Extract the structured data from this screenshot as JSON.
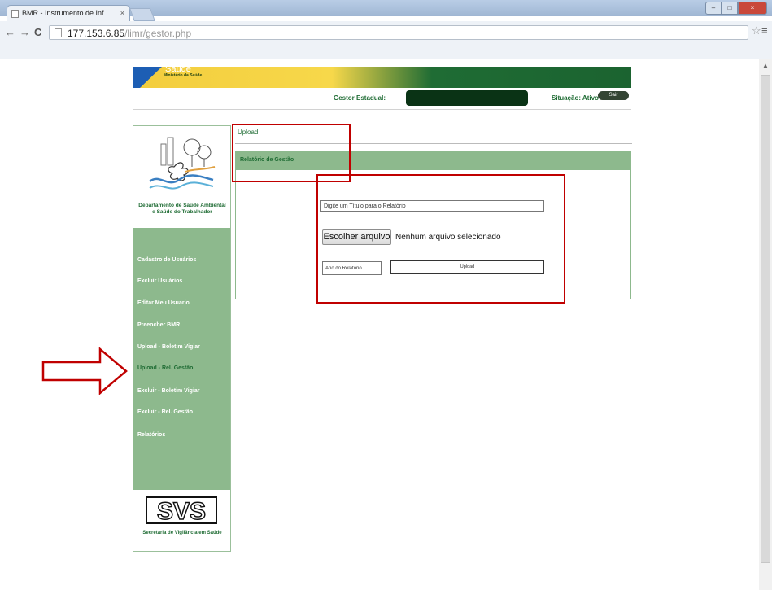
{
  "browser": {
    "tab_title": "BMR - Instrumento de Inf",
    "tab_close": "×",
    "url_host": "177.153.6.85",
    "url_path": "/limr/gestor.php",
    "back": "←",
    "forward": "→",
    "reload": "C",
    "star": "☆",
    "menu": "≡"
  },
  "header": {
    "brand": "Saúde",
    "ministry": "Ministério da Saúde",
    "gestor_label": "Gestor Estadual:",
    "situacao": "Situação: Ativo",
    "sair": "Sair"
  },
  "sidebar": {
    "department": "Departamento de Saúde Ambiental e Saúde do Trabalhador",
    "items": [
      {
        "label": "Cadastro de Usuários"
      },
      {
        "label": "Excluir Usuários"
      },
      {
        "label": "Editar Meu Usuario"
      },
      {
        "label": "Preencher BMR"
      },
      {
        "label": "Upload - Boletim Vigiar"
      },
      {
        "label": "Upload - Rel. Gestão"
      },
      {
        "label": "Excluir - Boletim Vigiar"
      },
      {
        "label": "Excluir - Rel. Gestão"
      },
      {
        "label": "Relatórios"
      }
    ],
    "active_index": 5,
    "svs_logo_text": "SVS",
    "svs_caption": "Secretaria de Vigilância em Saúde"
  },
  "main": {
    "section_title": "Upload",
    "panel_title": "Relatório de Gestão",
    "title_placeholder": "Digite um Título para o Relatório",
    "choose_file": "Escolher arquivo",
    "no_file": "Nenhum arquivo selecionado",
    "year_placeholder": "Ano do Relatório",
    "upload_button": "Upload"
  },
  "colors": {
    "green_dark": "#1f6c34",
    "green_light": "#8db98d",
    "annotation_red": "#c00000"
  }
}
